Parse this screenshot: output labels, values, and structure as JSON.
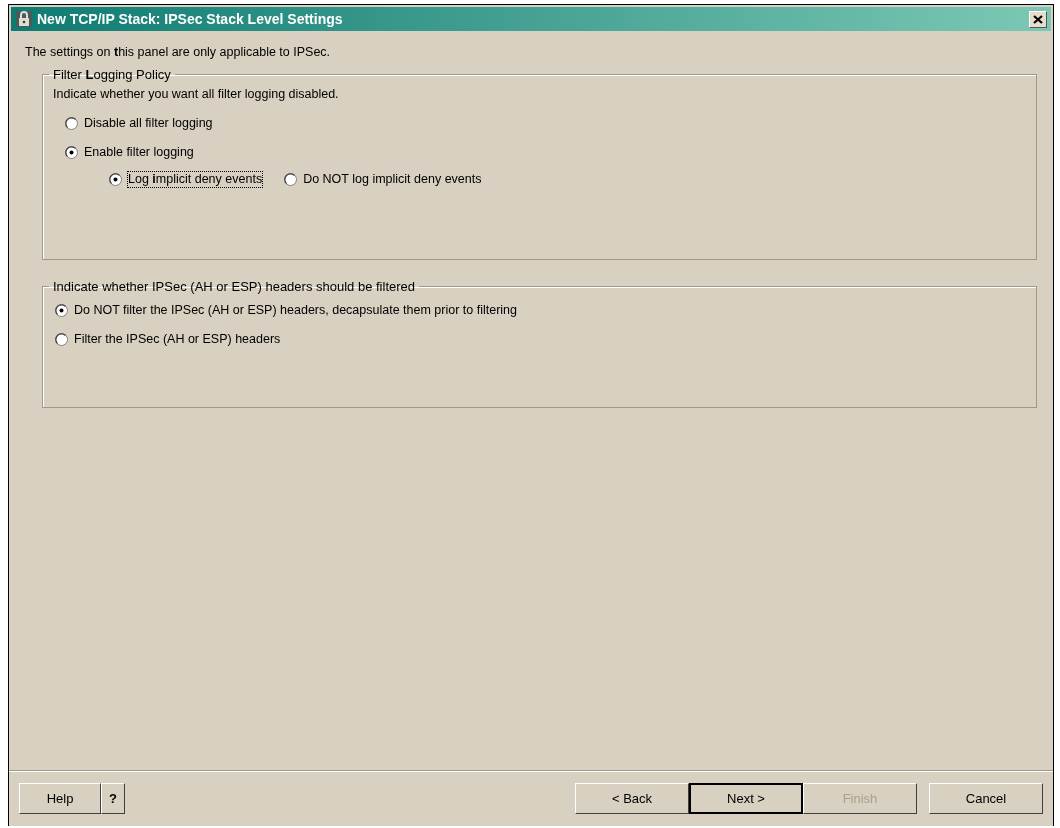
{
  "window": {
    "title": "New TCP/IP Stack: IPSec Stack Level Settings"
  },
  "intro": "The settings on **t**his panel are only applicable to IPSec.",
  "logging_group": {
    "legend": "Filter **L**ogging Policy",
    "prompt": "Indicate whether you want all filter logging disabled.",
    "options": [
      {
        "label": "Disable all filter logging",
        "selected": false
      },
      {
        "label": "Enable filter logging",
        "selected": true
      }
    ],
    "sub_options": [
      {
        "label": "Log **i**mplicit deny events",
        "selected": true,
        "focused": true
      },
      {
        "label": "Do NOT log implicit deny events",
        "selected": false,
        "focused": false
      }
    ]
  },
  "ipsec_group": {
    "legend": "Indicate whether IPSec (AH or ESP) headers should be filtered",
    "options": [
      {
        "label": "Do NOT filter the IPSec (AH or ESP) headers, decapsulate them prior to filtering",
        "selected": true
      },
      {
        "label": "Filter the IPSec (AH or ESP) headers",
        "selected": false
      }
    ]
  },
  "buttons": [
    {
      "label": "Help",
      "kind": "help",
      "disabled": false,
      "default": false
    },
    {
      "label": "?",
      "kind": "help",
      "disabled": false,
      "default": false
    },
    {
      "label": "< Back",
      "kind": "nav",
      "disabled": false,
      "default": false
    },
    {
      "label": "Next >",
      "kind": "nav",
      "disabled": false,
      "default": true
    },
    {
      "label": "Finish",
      "kind": "nav",
      "disabled": true,
      "default": false
    },
    {
      "label": "Cancel",
      "kind": "cancel",
      "disabled": false,
      "default": false
    }
  ]
}
